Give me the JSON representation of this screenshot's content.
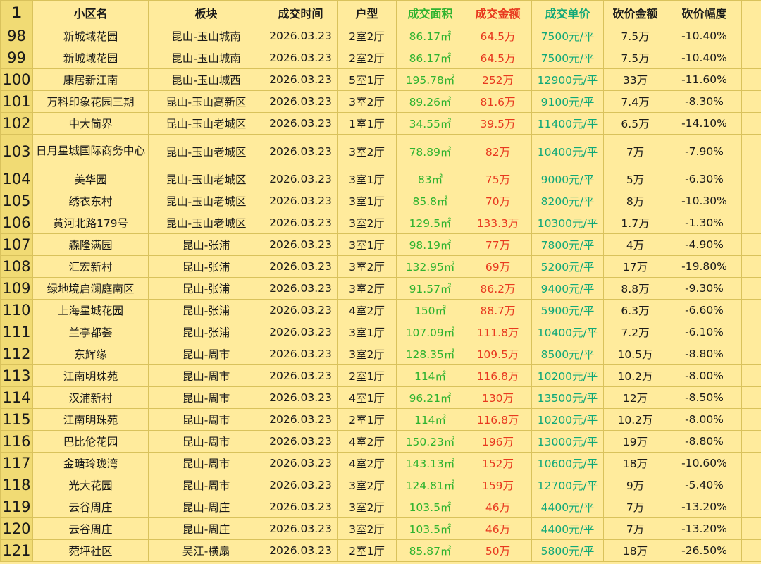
{
  "header_row_number": "1",
  "columns": [
    "小区名",
    "板块",
    "成交时间",
    "户型",
    "成交面积",
    "成交金额",
    "成交单价",
    "砍价金额",
    "砍价幅度"
  ],
  "colors": {
    "background": "#FFEB9C",
    "row_header": "#F1DB74",
    "area": "#2FB32F",
    "amount": "#E8391F",
    "unit_price": "#10A878"
  },
  "rows": [
    {
      "n": "98",
      "name": "新城域花园",
      "block": "昆山-玉山城南",
      "date": "2026.03.23",
      "layout": "2室2厅",
      "area": "86.17㎡",
      "amount": "64.5万",
      "price": "7500元/平",
      "cut": "7.5万",
      "pct": "-10.40%"
    },
    {
      "n": "99",
      "name": "新城域花园",
      "block": "昆山-玉山城南",
      "date": "2026.03.23",
      "layout": "2室2厅",
      "area": "86.17㎡",
      "amount": "64.5万",
      "price": "7500元/平",
      "cut": "7.5万",
      "pct": "-10.40%"
    },
    {
      "n": "100",
      "name": "康居新江南",
      "block": "昆山-玉山城西",
      "date": "2026.03.23",
      "layout": "5室1厅",
      "area": "195.78㎡",
      "amount": "252万",
      "price": "12900元/平",
      "cut": "33万",
      "pct": "-11.60%"
    },
    {
      "n": "101",
      "name": "万科印象花园三期",
      "block": "昆山-玉山高新区",
      "date": "2026.03.23",
      "layout": "3室2厅",
      "area": "89.26㎡",
      "amount": "81.6万",
      "price": "9100元/平",
      "cut": "7.4万",
      "pct": "-8.30%"
    },
    {
      "n": "102",
      "name": "中大简界",
      "block": "昆山-玉山老城区",
      "date": "2026.03.23",
      "layout": "1室1厅",
      "area": "34.55㎡",
      "amount": "39.5万",
      "price": "11400元/平",
      "cut": "6.5万",
      "pct": "-14.10%"
    },
    {
      "n": "103",
      "name": "日月星城国际商务中心",
      "block": "昆山-玉山老城区",
      "date": "2026.03.23",
      "layout": "3室2厅",
      "area": "78.89㎡",
      "amount": "82万",
      "price": "10400元/平",
      "cut": "7万",
      "pct": "-7.90%"
    },
    {
      "n": "104",
      "name": "美华园",
      "block": "昆山-玉山老城区",
      "date": "2026.03.23",
      "layout": "3室1厅",
      "area": "83㎡",
      "amount": "75万",
      "price": "9000元/平",
      "cut": "5万",
      "pct": "-6.30%"
    },
    {
      "n": "105",
      "name": "绣衣东村",
      "block": "昆山-玉山老城区",
      "date": "2026.03.23",
      "layout": "3室1厅",
      "area": "85.8㎡",
      "amount": "70万",
      "price": "8200元/平",
      "cut": "8万",
      "pct": "-10.30%"
    },
    {
      "n": "106",
      "name": "黄河北路179号",
      "block": "昆山-玉山老城区",
      "date": "2026.03.23",
      "layout": "3室2厅",
      "area": "129.5㎡",
      "amount": "133.3万",
      "price": "10300元/平",
      "cut": "1.7万",
      "pct": "-1.30%"
    },
    {
      "n": "107",
      "name": "森隆满园",
      "block": "昆山-张浦",
      "date": "2026.03.23",
      "layout": "3室1厅",
      "area": "98.19㎡",
      "amount": "77万",
      "price": "7800元/平",
      "cut": "4万",
      "pct": "-4.90%"
    },
    {
      "n": "108",
      "name": "汇宏新村",
      "block": "昆山-张浦",
      "date": "2026.03.23",
      "layout": "3室2厅",
      "area": "132.95㎡",
      "amount": "69万",
      "price": "5200元/平",
      "cut": "17万",
      "pct": "-19.80%"
    },
    {
      "n": "109",
      "name": "绿地境启澜庭南区",
      "block": "昆山-张浦",
      "date": "2026.03.23",
      "layout": "3室2厅",
      "area": "91.57㎡",
      "amount": "86.2万",
      "price": "9400元/平",
      "cut": "8.8万",
      "pct": "-9.30%"
    },
    {
      "n": "110",
      "name": "上海星城花园",
      "block": "昆山-张浦",
      "date": "2026.03.23",
      "layout": "4室2厅",
      "area": "150㎡",
      "amount": "88.7万",
      "price": "5900元/平",
      "cut": "6.3万",
      "pct": "-6.60%"
    },
    {
      "n": "111",
      "name": "兰亭都荟",
      "block": "昆山-张浦",
      "date": "2026.03.23",
      "layout": "3室1厅",
      "area": "107.09㎡",
      "amount": "111.8万",
      "price": "10400元/平",
      "cut": "7.2万",
      "pct": "-6.10%"
    },
    {
      "n": "112",
      "name": "东辉缘",
      "block": "昆山-周市",
      "date": "2026.03.23",
      "layout": "3室2厅",
      "area": "128.35㎡",
      "amount": "109.5万",
      "price": "8500元/平",
      "cut": "10.5万",
      "pct": "-8.80%"
    },
    {
      "n": "113",
      "name": "江南明珠苑",
      "block": "昆山-周市",
      "date": "2026.03.23",
      "layout": "2室1厅",
      "area": "114㎡",
      "amount": "116.8万",
      "price": "10200元/平",
      "cut": "10.2万",
      "pct": "-8.00%"
    },
    {
      "n": "114",
      "name": "汉浦新村",
      "block": "昆山-周市",
      "date": "2026.03.23",
      "layout": "4室1厅",
      "area": "96.21㎡",
      "amount": "130万",
      "price": "13500元/平",
      "cut": "12万",
      "pct": "-8.50%"
    },
    {
      "n": "115",
      "name": "江南明珠苑",
      "block": "昆山-周市",
      "date": "2026.03.23",
      "layout": "2室1厅",
      "area": "114㎡",
      "amount": "116.8万",
      "price": "10200元/平",
      "cut": "10.2万",
      "pct": "-8.00%"
    },
    {
      "n": "116",
      "name": "巴比伦花园",
      "block": "昆山-周市",
      "date": "2026.03.23",
      "layout": "4室2厅",
      "area": "150.23㎡",
      "amount": "196万",
      "price": "13000元/平",
      "cut": "19万",
      "pct": "-8.80%"
    },
    {
      "n": "117",
      "name": "金瑭玲珑湾",
      "block": "昆山-周市",
      "date": "2026.03.23",
      "layout": "4室2厅",
      "area": "143.13㎡",
      "amount": "152万",
      "price": "10600元/平",
      "cut": "18万",
      "pct": "-10.60%"
    },
    {
      "n": "118",
      "name": "光大花园",
      "block": "昆山-周市",
      "date": "2026.03.23",
      "layout": "3室2厅",
      "area": "124.81㎡",
      "amount": "159万",
      "price": "12700元/平",
      "cut": "9万",
      "pct": "-5.40%"
    },
    {
      "n": "119",
      "name": "云谷周庄",
      "block": "昆山-周庄",
      "date": "2026.03.23",
      "layout": "3室2厅",
      "area": "103.5㎡",
      "amount": "46万",
      "price": "4400元/平",
      "cut": "7万",
      "pct": "-13.20%"
    },
    {
      "n": "120",
      "name": "云谷周庄",
      "block": "昆山-周庄",
      "date": "2026.03.23",
      "layout": "3室2厅",
      "area": "103.5㎡",
      "amount": "46万",
      "price": "4400元/平",
      "cut": "7万",
      "pct": "-13.20%"
    },
    {
      "n": "121",
      "name": "菀坪社区",
      "block": "吴江-横扇",
      "date": "2026.03.23",
      "layout": "2室1厅",
      "area": "85.87㎡",
      "amount": "50万",
      "price": "5800元/平",
      "cut": "18万",
      "pct": "-26.50%"
    }
  ]
}
